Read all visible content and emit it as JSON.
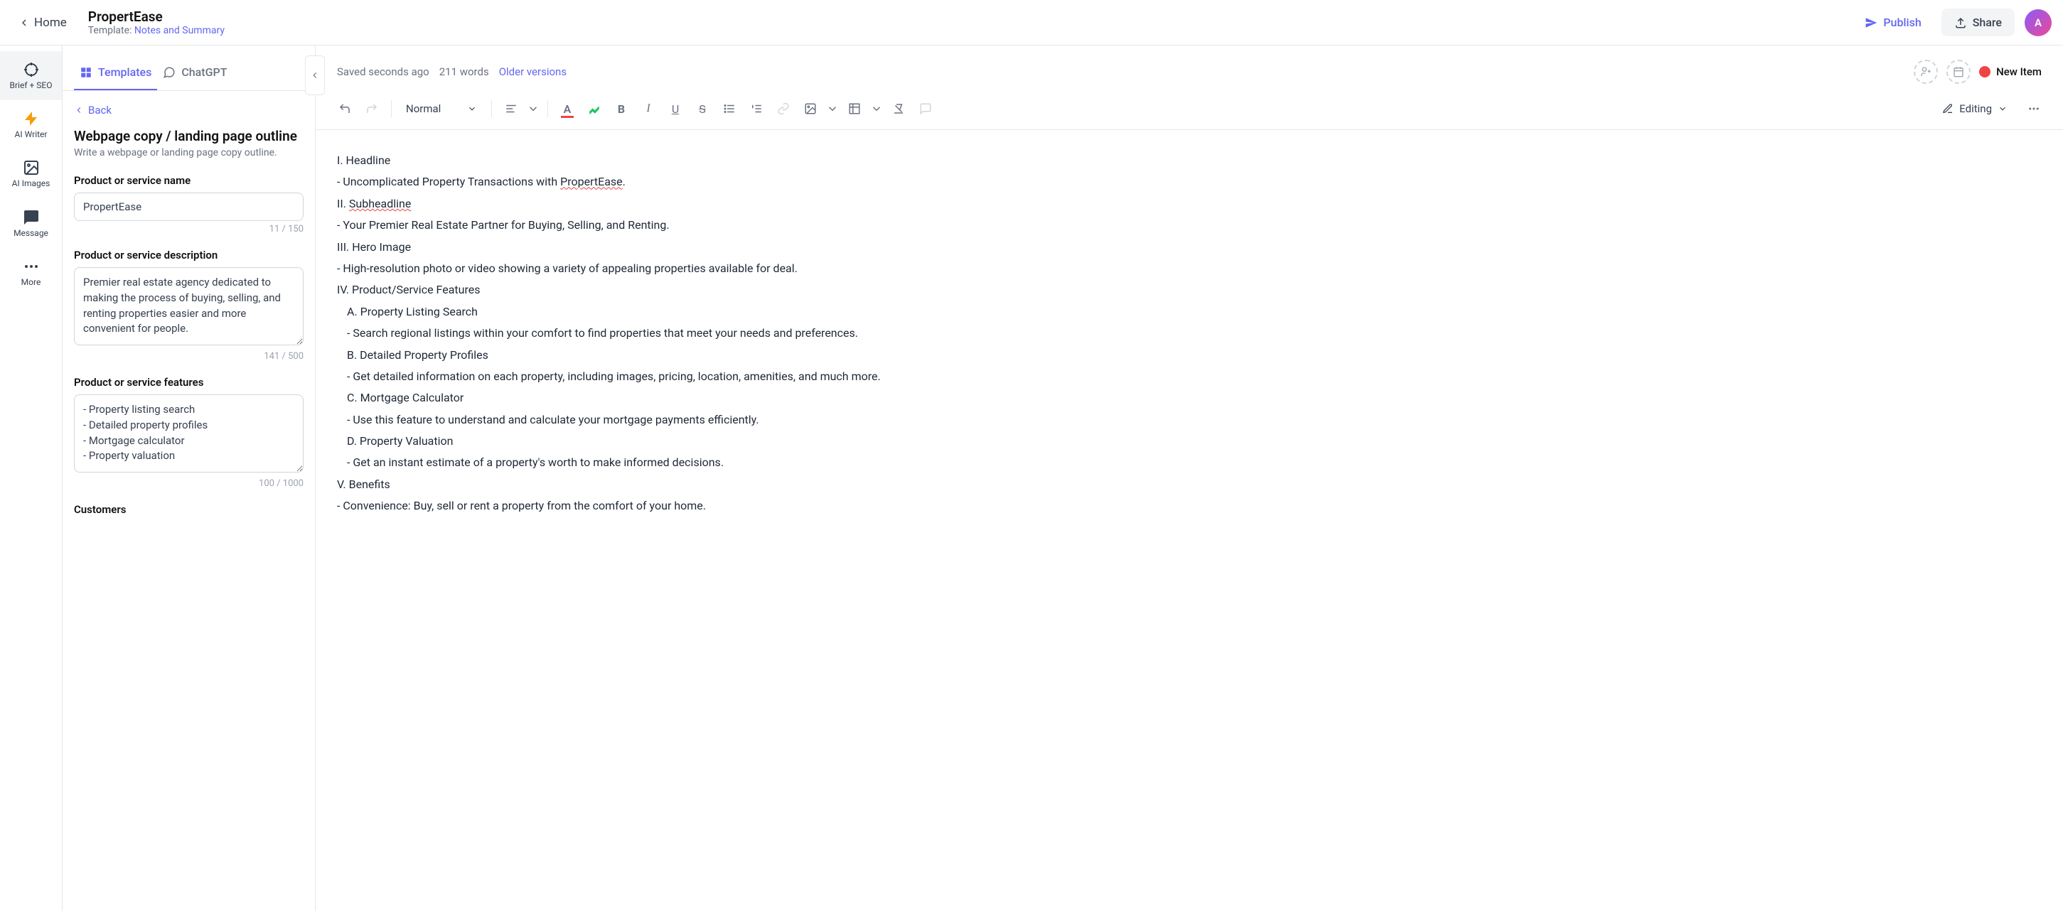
{
  "topbar": {
    "home": "Home",
    "title": "PropertEase",
    "template_prefix": "Template: ",
    "template_name": "Notes and Summary",
    "publish": "Publish",
    "share": "Share"
  },
  "rail": {
    "items": [
      {
        "label": "Brief + SEO"
      },
      {
        "label": "AI Writer"
      },
      {
        "label": "AI Images"
      },
      {
        "label": "Message"
      },
      {
        "label": "More"
      }
    ]
  },
  "panel": {
    "tabs": {
      "templates": "Templates",
      "chatgpt": "ChatGPT"
    },
    "back": "Back",
    "title": "Webpage copy / landing page outline",
    "subtitle": "Write a webpage or landing page copy outline.",
    "fields": {
      "name_label": "Product or service name",
      "name_value": "PropertEase",
      "name_counter": "11 / 150",
      "desc_label": "Product or service description",
      "desc_value": "Premier real estate agency dedicated to making the process of buying, selling, and renting properties easier and more convenient for people.",
      "desc_counter": "141 / 500",
      "feat_label": "Product or service features",
      "feat_value": "- Property listing search\n- Detailed property profiles\n- Mortgage calculator\n- Property valuation",
      "feat_counter": "100 / 1000",
      "cust_label": "Customers"
    }
  },
  "editor": {
    "saved": "Saved seconds ago",
    "words": "211 words",
    "older": "Older versions",
    "new_item": "New Item",
    "format": "Normal",
    "mode": "Editing"
  },
  "doc": {
    "l1a": "I. Headline",
    "l2_prefix": "- Uncomplicated Property Transactions with ",
    "l2_brand": "PropertEase",
    "l2_suffix": ".",
    "l3_prefix": "II. ",
    "l3_rl": "Subheadline",
    "l4": "- Your Premier Real Estate Partner for Buying, Selling, and Renting.",
    "l5": "III. Hero Image",
    "l6": "- High-resolution photo or video showing a variety of appealing properties available for deal.",
    "l7": "IV. Product/Service Features",
    "l8": "A. Property Listing Search",
    "l9": "- Search regional listings within your comfort to find properties that meet your needs and preferences.",
    "l10": "B. Detailed Property Profiles",
    "l11": "- Get detailed information on each property, including images, pricing, location, amenities, and much more.",
    "l12": "C. Mortgage Calculator",
    "l13": "- Use this feature to understand and calculate your mortgage payments efficiently.",
    "l14": "D. Property Valuation",
    "l15": "- Get an instant estimate of a property's worth to make informed decisions.",
    "l16": "V. Benefits",
    "l17": "- Convenience: Buy, sell or rent a property from the comfort of your home."
  }
}
